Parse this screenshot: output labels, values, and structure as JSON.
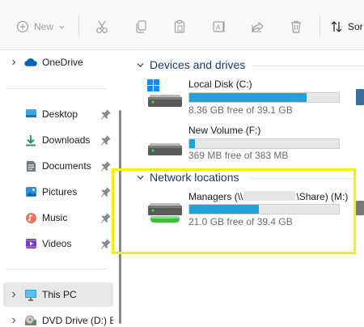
{
  "toolbar": {
    "new_label": "New",
    "sort_label": "Sor",
    "icons": [
      "add-icon",
      "chevron-down-icon",
      "cut-icon",
      "copy-icon",
      "paste-icon",
      "rename-icon",
      "share-icon",
      "delete-icon",
      "sort-icon"
    ]
  },
  "nav": {
    "items": [
      {
        "label": "OneDrive",
        "icon": "cloud-icon"
      },
      {
        "label": "Desktop",
        "icon": "desktop-icon",
        "pinned": true
      },
      {
        "label": "Downloads",
        "icon": "download-icon",
        "pinned": true
      },
      {
        "label": "Documents",
        "icon": "document-icon",
        "pinned": true
      },
      {
        "label": "Pictures",
        "icon": "picture-icon",
        "pinned": true
      },
      {
        "label": "Music",
        "icon": "music-icon",
        "pinned": true
      },
      {
        "label": "Videos",
        "icon": "video-icon",
        "pinned": true
      },
      {
        "label": "This PC",
        "icon": "computer-icon",
        "selected": true
      },
      {
        "label": "DVD Drive (D:) E",
        "icon": "dvd-icon"
      }
    ]
  },
  "sections": {
    "devices": {
      "title": "Devices and drives"
    },
    "network": {
      "title": "Network locations"
    }
  },
  "drives": [
    {
      "name": "Local Disk (C:)",
      "free_text": "8.36 GB free of 39.1 GB",
      "used_fraction": 0.786,
      "icon": "windows-drive-icon"
    },
    {
      "name": "New Volume (F:)",
      "free_text": "369 MB free of 383 MB",
      "used_fraction": 0.037,
      "icon": "drive-icon"
    }
  ],
  "network_drives": [
    {
      "name_prefix": "Managers (\\\\",
      "name_suffix": "\\Share) (M:)",
      "free_text": "21.0 GB free of 39.4 GB",
      "used_fraction": 0.467,
      "icon": "network-drive-icon"
    }
  ],
  "colors": {
    "accent": "#26a0da",
    "highlight": "#f4f200",
    "section_title": "#1c3a6b",
    "selected_bg": "#e8e8e8"
  }
}
